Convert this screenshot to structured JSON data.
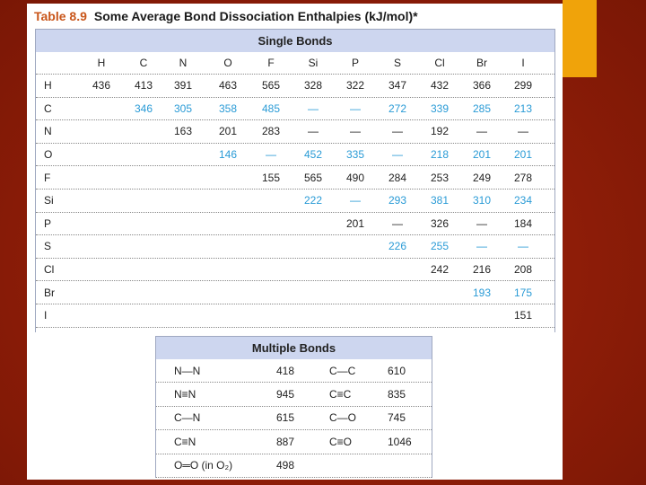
{
  "title": {
    "number": "Table 8.9",
    "text": "Some Average Bond Dissociation Enthalpies (kJ/mol)*"
  },
  "single_bonds": {
    "header": "Single Bonds",
    "columns": [
      "H",
      "C",
      "N",
      "O",
      "F",
      "Si",
      "P",
      "S",
      "Cl",
      "Br",
      "I"
    ],
    "rows": [
      {
        "label": "H",
        "cells": [
          "436",
          "413",
          "391",
          "463",
          "565",
          "328",
          "322",
          "347",
          "432",
          "366",
          "299"
        ]
      },
      {
        "label": "C",
        "cells": [
          "",
          "346",
          "305",
          "358",
          "485",
          "—",
          "—",
          "272",
          "339",
          "285",
          "213"
        ]
      },
      {
        "label": "N",
        "cells": [
          "",
          "",
          "163",
          "201",
          "283",
          "—",
          "—",
          "—",
          "192",
          "—",
          "—"
        ]
      },
      {
        "label": "O",
        "cells": [
          "",
          "",
          "",
          "146",
          "—",
          "452",
          "335",
          "—",
          "218",
          "201",
          "201"
        ]
      },
      {
        "label": "F",
        "cells": [
          "",
          "",
          "",
          "",
          "155",
          "565",
          "490",
          "284",
          "253",
          "249",
          "278"
        ]
      },
      {
        "label": "Si",
        "cells": [
          "",
          "",
          "",
          "",
          "",
          "222",
          "—",
          "293",
          "381",
          "310",
          "234"
        ]
      },
      {
        "label": "P",
        "cells": [
          "",
          "",
          "",
          "",
          "",
          "",
          "201",
          "—",
          "326",
          "—",
          "184"
        ]
      },
      {
        "label": "S",
        "cells": [
          "",
          "",
          "",
          "",
          "",
          "",
          "",
          "226",
          "255",
          "—",
          "—"
        ]
      },
      {
        "label": "Cl",
        "cells": [
          "",
          "",
          "",
          "",
          "",
          "",
          "",
          "",
          "242",
          "216",
          "208"
        ]
      },
      {
        "label": "Br",
        "cells": [
          "",
          "",
          "",
          "",
          "",
          "",
          "",
          "",
          "",
          "193",
          "175"
        ]
      },
      {
        "label": "I",
        "cells": [
          "",
          "",
          "",
          "",
          "",
          "",
          "",
          "",
          "",
          "",
          "151"
        ]
      }
    ]
  },
  "multiple_bonds": {
    "header": "Multiple Bonds",
    "rows": [
      {
        "bond1": "N—N",
        "value1": "418",
        "bond2": "C—C",
        "value2": "610"
      },
      {
        "bond1": "N≡N",
        "value1": "945",
        "bond2": "C≡C",
        "value2": "835"
      },
      {
        "bond1": "C—N",
        "value1": "615",
        "bond2": "C—O",
        "value2": "745"
      },
      {
        "bond1": "C≡N",
        "value1": "887",
        "bond2": "C≡O",
        "value2": "1046"
      },
      {
        "bond1": "O═O (in O₂)",
        "value1": "498",
        "bond2": "",
        "value2": ""
      }
    ]
  },
  "colors": {
    "highlight": "#2a9bd6",
    "header_bg": "#cdd6ef",
    "title_number": "#c9561a",
    "accent": "#f0a30a"
  }
}
